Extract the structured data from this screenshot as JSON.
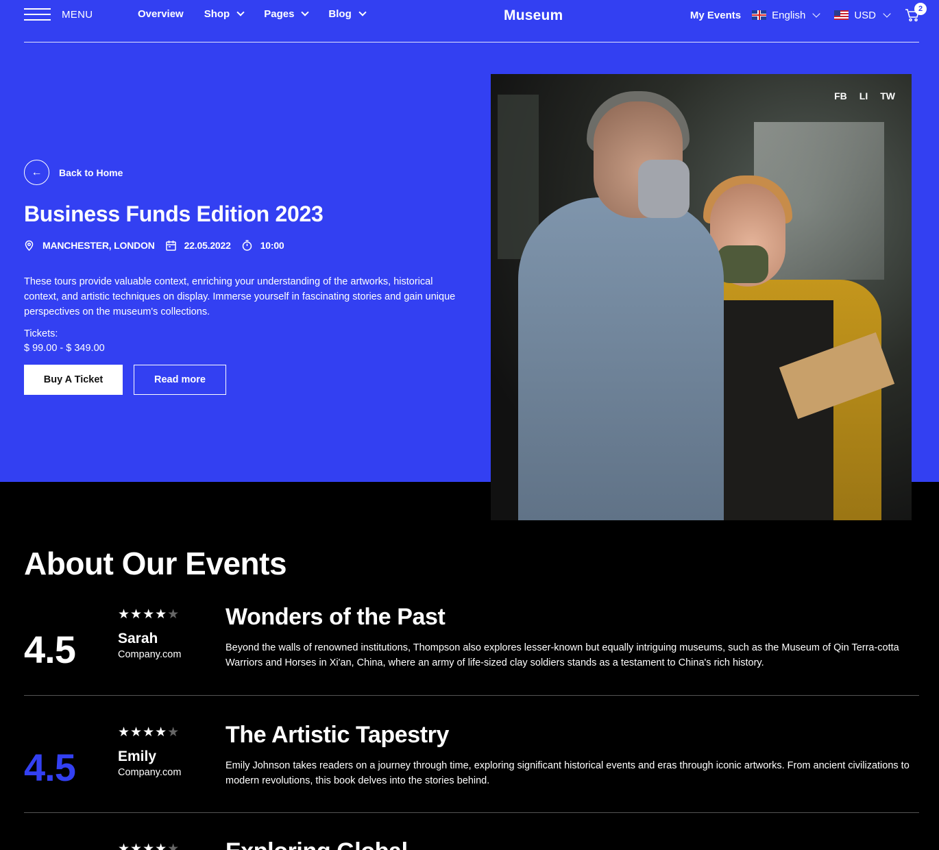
{
  "nav": {
    "menu_label": "MENU",
    "links": [
      {
        "label": "Overview",
        "dropdown": false
      },
      {
        "label": "Shop",
        "dropdown": true
      },
      {
        "label": "Pages",
        "dropdown": true
      },
      {
        "label": "Blog",
        "dropdown": true
      }
    ],
    "brand": "Museum",
    "my_events": "My Events",
    "language": "English",
    "currency": "USD",
    "cart_count": "2"
  },
  "hero": {
    "back_label": "Back to Home",
    "title": "Business Funds Edition 2023",
    "location": "MANCHESTER, LONDON",
    "date": "22.05.2022",
    "time": "10:00",
    "description": "These tours provide valuable context, enriching your understanding of the artworks, historical context, and artistic techniques on display. Immerse yourself in fascinating stories and gain unique perspectives on the museum's collections.",
    "tickets_label": "Tickets:",
    "tickets_price": "$ 99.00 - $ 349.00",
    "buy_label": "Buy A Ticket",
    "read_label": "Read more",
    "social": [
      "FB",
      "LI",
      "TW"
    ]
  },
  "about": {
    "title": "About Our Events",
    "events": [
      {
        "rating": "4.5",
        "stars_filled": "★★★★",
        "stars_empty": "★",
        "reviewer": "Sarah",
        "company": "Company.com",
        "title": "Wonders of the Past",
        "description": "Beyond the walls of renowned institutions, Thompson also explores lesser-known but equally intriguing museums, such as the Museum of Qin Terra-cotta Warriors and Horses in Xi'an, China, where an army of life-sized clay soldiers stands as a testament to China's rich history."
      },
      {
        "rating": "4.5",
        "stars_filled": "★★★★",
        "stars_empty": "★",
        "reviewer": "Emily",
        "company": "Company.com",
        "title": "The Artistic Tapestry",
        "description": "Emily Johnson takes readers on a journey through time, exploring significant historical events and eras through iconic artworks. From ancient civilizations to modern revolutions, this book delves into the stories behind."
      },
      {
        "rating": "",
        "stars_filled": "★★★★",
        "stars_empty": "★",
        "reviewer": "",
        "company": "",
        "title": "Exploring Global",
        "description": ""
      }
    ]
  },
  "colors": {
    "accent": "#3340f2",
    "background": "#000000"
  }
}
